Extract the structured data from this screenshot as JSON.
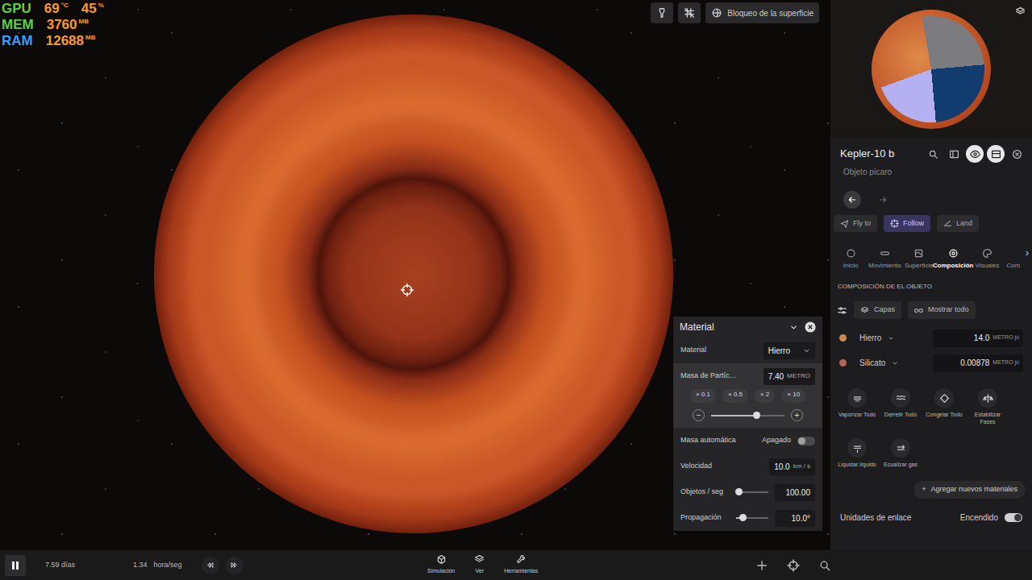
{
  "hud": [
    {
      "label": "GPU",
      "color": "#5ccf45",
      "values": [
        {
          "value": "69",
          "unit": "°C"
        },
        {
          "value": "45",
          "unit": "%"
        }
      ]
    },
    {
      "label": "MEM",
      "color": "#5ccf45",
      "values": [
        {
          "value": "3760",
          "unit": "MB"
        }
      ]
    },
    {
      "label": "RAM",
      "color": "#3a9cff",
      "values": [
        {
          "value": "12688",
          "unit": "MB"
        }
      ]
    }
  ],
  "toolbar": {
    "surface_lock": "Bloqueo de la superficie"
  },
  "popup": {
    "title": "Material",
    "material": {
      "label": "Material",
      "value": "Hierro"
    },
    "mass": {
      "label": "Masa de Partíc…",
      "value": "7.40",
      "unit": "METRO",
      "multipliers": [
        "× 0.1",
        "× 0.5",
        "× 2",
        "× 10"
      ],
      "minus": "−",
      "plus": "+",
      "level": 0.62
    },
    "auto_mass": {
      "label": "Masa automática",
      "state": "Apagado",
      "on": false
    },
    "velocity": {
      "label": "Velocidad",
      "value": "10.0",
      "unit": "km / s"
    },
    "rate": {
      "label": "Objetos / seg",
      "value": "100.00",
      "level": 0.08
    },
    "spread": {
      "label": "Propagación",
      "value": "10.0°",
      "level": 0.2
    }
  },
  "panel": {
    "title": "Kepler-10 b",
    "header_buttons": [
      {
        "selected": false
      },
      {
        "selected": false
      },
      {
        "selected": true
      },
      {
        "selected": true
      },
      {
        "selected": false
      }
    ],
    "subtitle": "Objeto pícaro",
    "nav": {
      "back_enabled": true,
      "forward_enabled": false
    },
    "actions": [
      {
        "label": "Fly to",
        "selected": false
      },
      {
        "label": "Follow",
        "selected": true
      },
      {
        "label": "Land",
        "selected": false
      }
    ],
    "tabs": [
      {
        "label": "Inicio",
        "selected": false
      },
      {
        "label": "Movimiento",
        "selected": false
      },
      {
        "label": "Superficie",
        "selected": false
      },
      {
        "label": "Composición",
        "selected": true
      },
      {
        "label": "Visuales",
        "selected": false
      },
      {
        "label": "Com",
        "selected": false
      }
    ],
    "tabs_more": "›",
    "section": "COMPOSICIÓN DE EL OBJETO",
    "view_buttons": [
      "Capas",
      "Mostrar todo"
    ],
    "materials": [
      {
        "name": "Hierro",
        "value": "14.0",
        "unit": "METRO jú",
        "color": "#c98755"
      },
      {
        "name": "Silicato",
        "value": "0.00878",
        "unit": "METRO jú",
        "color": "#b5645a"
      }
    ],
    "tools": [
      {
        "label": "Vaporizar Todo"
      },
      {
        "label": "Derretir Todo"
      },
      {
        "label": "Congelar Todo"
      },
      {
        "label": "Estabilizar Fases"
      },
      {
        "label": "Liquidar líquido"
      },
      {
        "label": "Ecualizar gas"
      }
    ],
    "add": {
      "icon": "+",
      "label": "Agregar nuevos materiales"
    },
    "link_units": {
      "label": "Unidades de enlace",
      "state": "Encendido",
      "on": true
    }
  },
  "bottom": {
    "playing": true,
    "time": "7.59 días",
    "speed": "1.34",
    "speed_unit": "hora/seg",
    "menus": [
      {
        "label": "Simulación"
      },
      {
        "label": "Ver"
      },
      {
        "label": "Herramientas"
      }
    ]
  }
}
